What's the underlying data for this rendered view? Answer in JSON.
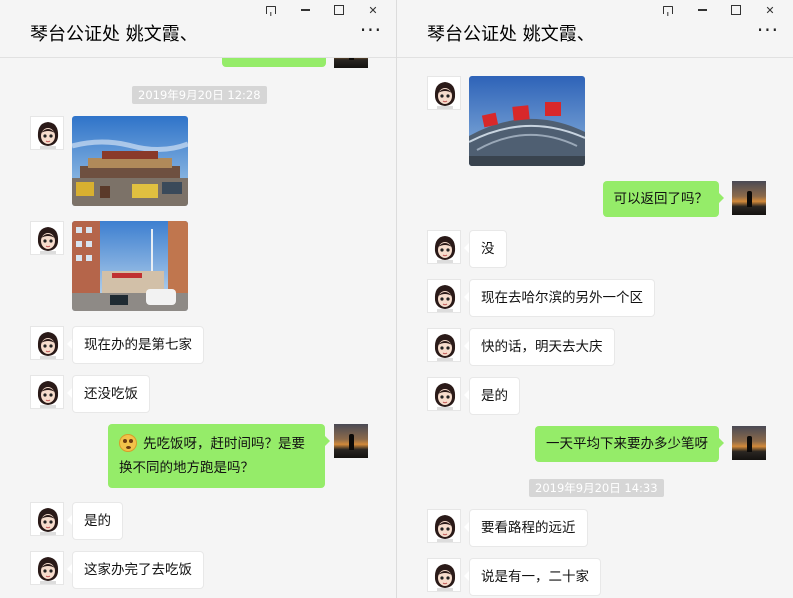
{
  "window_controls": {
    "pin": "pin-icon",
    "minimize": "minimize-icon",
    "maximize": "maximize-icon",
    "close": "✕"
  },
  "left": {
    "title": "琴台公证处 姚文霞、",
    "more": "···",
    "timestamp": "2019年9月20日 12:28",
    "messages": [
      {
        "text": "现在办的是第七家"
      },
      {
        "text": "还没吃饭"
      },
      {
        "text": "先吃饭呀，赶时间吗？是要换不同的地方跑是吗？",
        "emoji": "dizzy-face-emoji"
      },
      {
        "text": "是的"
      },
      {
        "text": "这家办完了去吃饭"
      }
    ]
  },
  "right": {
    "title": "琴台公证处 姚文霞、",
    "more": "···",
    "timestamp": "2019年9月20日 14:33",
    "messages": [
      {
        "text": "可以返回了吗？"
      },
      {
        "text": "没"
      },
      {
        "text": "现在去哈尔滨的另外一个区"
      },
      {
        "text": "快的话，明天去大庆"
      },
      {
        "text": "是的"
      },
      {
        "text": "一天平均下来要办多少笔呀"
      },
      {
        "text": "要看路程的远近"
      },
      {
        "text": "说是有一，二十家"
      }
    ]
  },
  "colors": {
    "sent_bubble": "#95ec69",
    "received_bubble": "#ffffff",
    "background": "#f5f5f5",
    "timestamp_bg": "#d6d6d6"
  }
}
